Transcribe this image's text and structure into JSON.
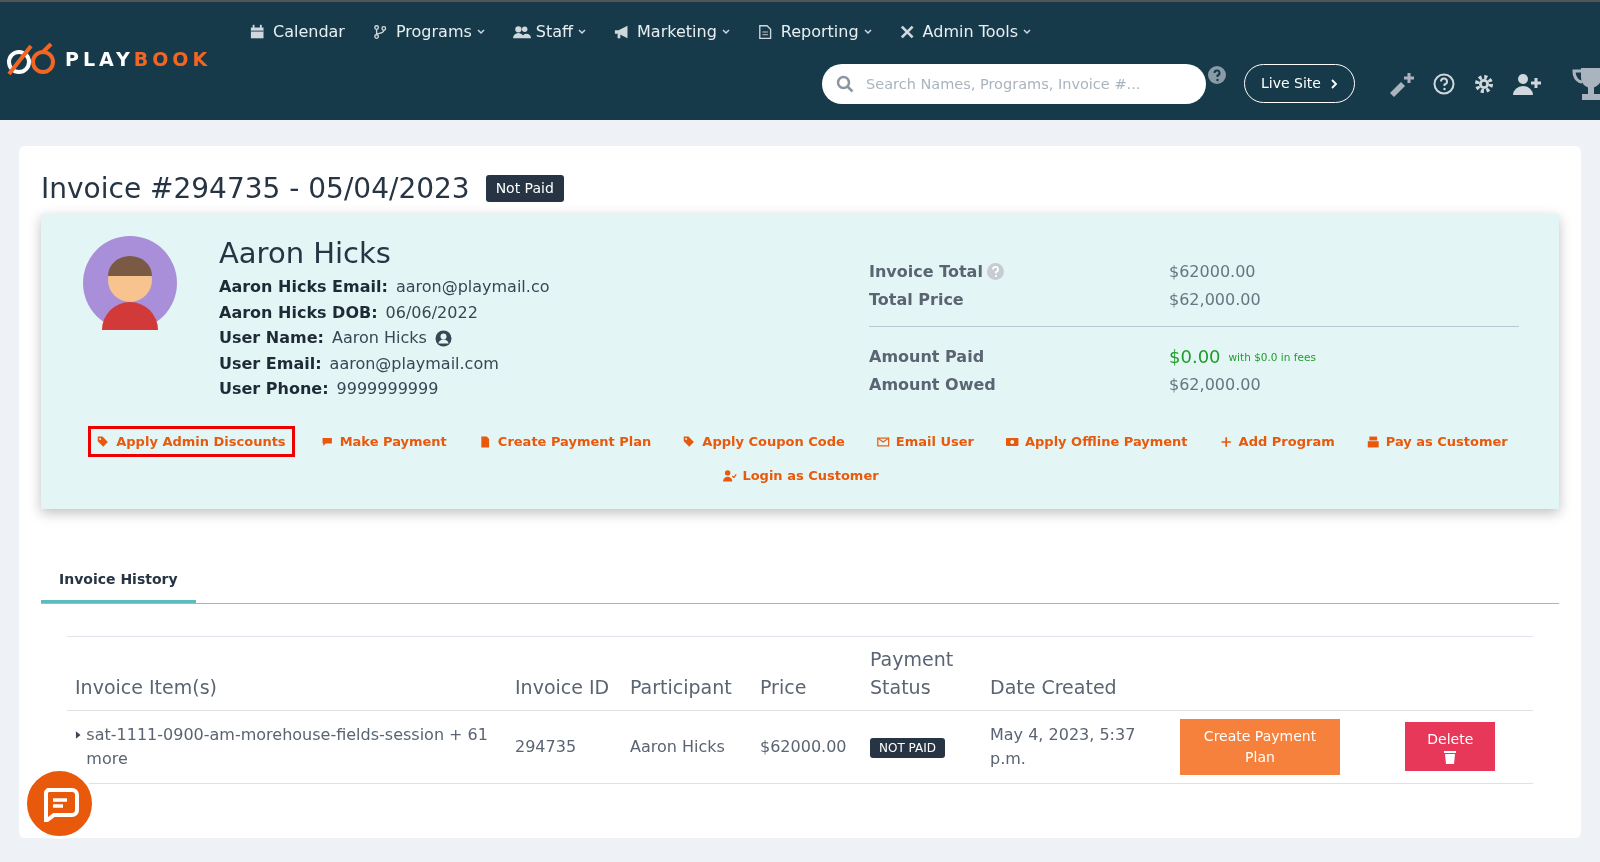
{
  "brand": {
    "part_1": "PLAY",
    "part_2": "BOOK"
  },
  "nav": [
    {
      "label": "Calendar",
      "dropdown": false
    },
    {
      "label": "Programs",
      "dropdown": true
    },
    {
      "label": "Staff",
      "dropdown": true
    },
    {
      "label": "Marketing",
      "dropdown": true
    },
    {
      "label": "Reporting",
      "dropdown": true
    },
    {
      "label": "Admin Tools",
      "dropdown": true
    }
  ],
  "search": {
    "placeholder": "Search Names, Programs, Invoice #..."
  },
  "live_site": "Live Site",
  "invoice": {
    "title": "Invoice #294735 - 05/04/2023",
    "status_badge": "Not Paid"
  },
  "customer": {
    "name": "Aaron Hicks",
    "fields": [
      {
        "label": "Aaron Hicks Email:",
        "value": "aaron@playmail.co",
        "user_icon": false
      },
      {
        "label": "Aaron Hicks DOB:",
        "value": "06/06/2022",
        "user_icon": false
      },
      {
        "label": "User Name:",
        "value": "Aaron Hicks",
        "user_icon": true
      },
      {
        "label": "User Email:",
        "value": "aaron@playmail.com",
        "user_icon": false
      },
      {
        "label": "User Phone:",
        "value": "9999999999",
        "user_icon": false
      }
    ]
  },
  "totals": [
    {
      "label": "Invoice Total",
      "value": "$62000.00",
      "help": true,
      "kind": "plain"
    },
    {
      "label": "Total Price",
      "value": "$62,000.00",
      "help": false,
      "kind": "plain"
    },
    {
      "label": "Amount Paid",
      "value": "$0.00",
      "note": "with $0.0 in fees",
      "help": false,
      "kind": "paid"
    },
    {
      "label": "Amount Owed",
      "value": "$62,000.00",
      "help": false,
      "kind": "plain"
    }
  ],
  "actions": [
    {
      "label": "Apply Admin Discounts",
      "highlighted": true
    },
    {
      "label": "Make Payment",
      "highlighted": false
    },
    {
      "label": "Create Payment Plan",
      "highlighted": false
    },
    {
      "label": "Apply Coupon Code",
      "highlighted": false
    },
    {
      "label": "Email User",
      "highlighted": false
    },
    {
      "label": "Apply Offline Payment",
      "highlighted": false
    },
    {
      "label": "Add Program",
      "highlighted": false
    },
    {
      "label": "Pay as Customer",
      "highlighted": false
    },
    {
      "label": "Login as Customer",
      "highlighted": false
    }
  ],
  "tabs": [
    {
      "label": "Invoice History",
      "selected": true
    }
  ],
  "table": {
    "columns": [
      "Invoice Item(s)",
      "Invoice ID",
      "Participant",
      "Price",
      "Payment Status",
      "Date Created"
    ],
    "rows": [
      {
        "item": "sat-1111-0900-am-morehouse-fields-session + 61 more",
        "invoice_id": "294735",
        "participant": "Aaron Hicks",
        "price": "$62000.00",
        "payment_status": "NOT PAID",
        "date_created": "May 4, 2023, 5:37 p.m.",
        "plan_button": "Create Payment Plan",
        "delete_button": "Delete"
      }
    ]
  }
}
